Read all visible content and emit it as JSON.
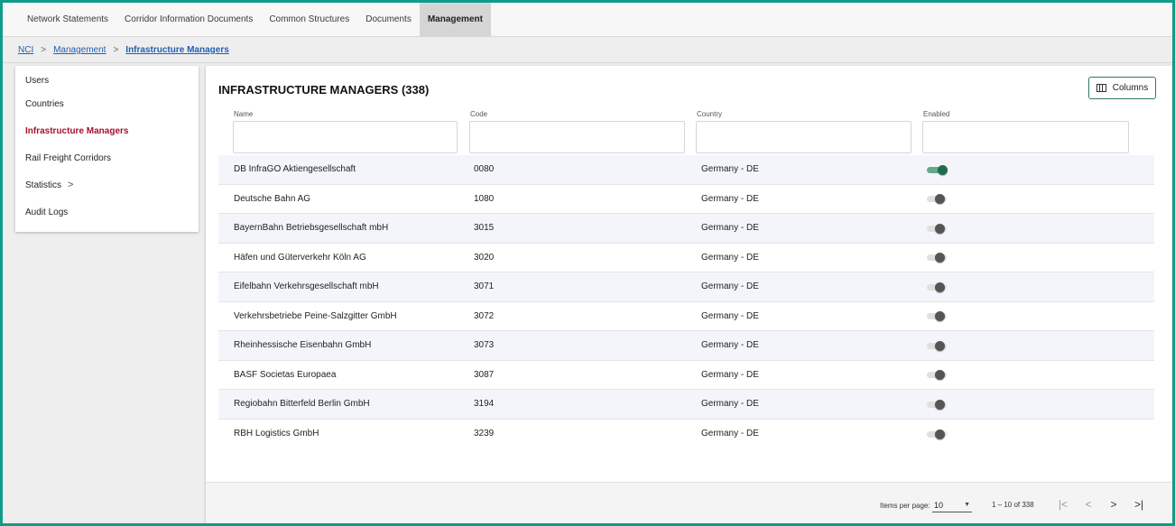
{
  "topnav": {
    "tabs": [
      {
        "label": "Network Statements",
        "active": false
      },
      {
        "label": "Corridor Information Documents",
        "active": false
      },
      {
        "label": "Common Structures",
        "active": false
      },
      {
        "label": "Documents",
        "active": false
      },
      {
        "label": "Management",
        "active": true
      }
    ]
  },
  "breadcrumb": {
    "items": [
      "NCI",
      "Management",
      "Infrastructure Managers"
    ],
    "separator": ">"
  },
  "sidebar": {
    "items": [
      {
        "label": "Users",
        "active": false
      },
      {
        "label": "Countries",
        "active": false
      },
      {
        "label": "Infrastructure Managers",
        "active": true
      },
      {
        "label": "Rail Freight Corridors",
        "active": false
      },
      {
        "label": "Statistics",
        "active": false,
        "chevron": ">"
      },
      {
        "label": "Audit Logs",
        "active": false
      }
    ]
  },
  "main": {
    "title": "INFRASTRUCTURE MANAGERS (338)",
    "columns_button": "Columns",
    "filters": [
      {
        "label": "Name",
        "value": ""
      },
      {
        "label": "Code",
        "value": ""
      },
      {
        "label": "Country",
        "value": ""
      },
      {
        "label": "Enabled",
        "value": ""
      }
    ],
    "rows": [
      {
        "name": "DB InfraGO Aktiengesellschaft",
        "code": "0080",
        "country": "Germany - DE",
        "enabled": true
      },
      {
        "name": "Deutsche Bahn AG",
        "code": "1080",
        "country": "Germany - DE",
        "enabled": false
      },
      {
        "name": "BayernBahn Betriebsgesellschaft mbH",
        "code": "3015",
        "country": "Germany - DE",
        "enabled": false
      },
      {
        "name": "Häfen und Güterverkehr Köln AG",
        "code": "3020",
        "country": "Germany - DE",
        "enabled": false
      },
      {
        "name": "Eifelbahn Verkehrsgesellschaft mbH",
        "code": "3071",
        "country": "Germany - DE",
        "enabled": false
      },
      {
        "name": "Verkehrsbetriebe Peine-Salzgitter GmbH",
        "code": "3072",
        "country": "Germany - DE",
        "enabled": false
      },
      {
        "name": "Rheinhessische Eisenbahn GmbH",
        "code": "3073",
        "country": "Germany - DE",
        "enabled": false
      },
      {
        "name": "BASF Societas Europaea",
        "code": "3087",
        "country": "Germany - DE",
        "enabled": false
      },
      {
        "name": "Regiobahn Bitterfeld Berlin GmbH",
        "code": "3194",
        "country": "Germany - DE",
        "enabled": false
      },
      {
        "name": "RBH Logistics GmbH",
        "code": "3239",
        "country": "Germany - DE",
        "enabled": false
      }
    ]
  },
  "paginator": {
    "items_per_page_label": "Items per page:",
    "items_per_page_value": "10",
    "range_label": "1 – 10 of 338",
    "first_icon": "first-page-icon",
    "prev_icon": "previous-page-icon",
    "next_icon": "next-page-icon",
    "last_icon": "last-page-icon"
  },
  "colors": {
    "frame_border": "#119b8a",
    "active_sidebar": "#a5122a",
    "link": "#1e5fb3",
    "toggle_on": "#1f6e4a",
    "row_alt": "#f3f5fb"
  }
}
